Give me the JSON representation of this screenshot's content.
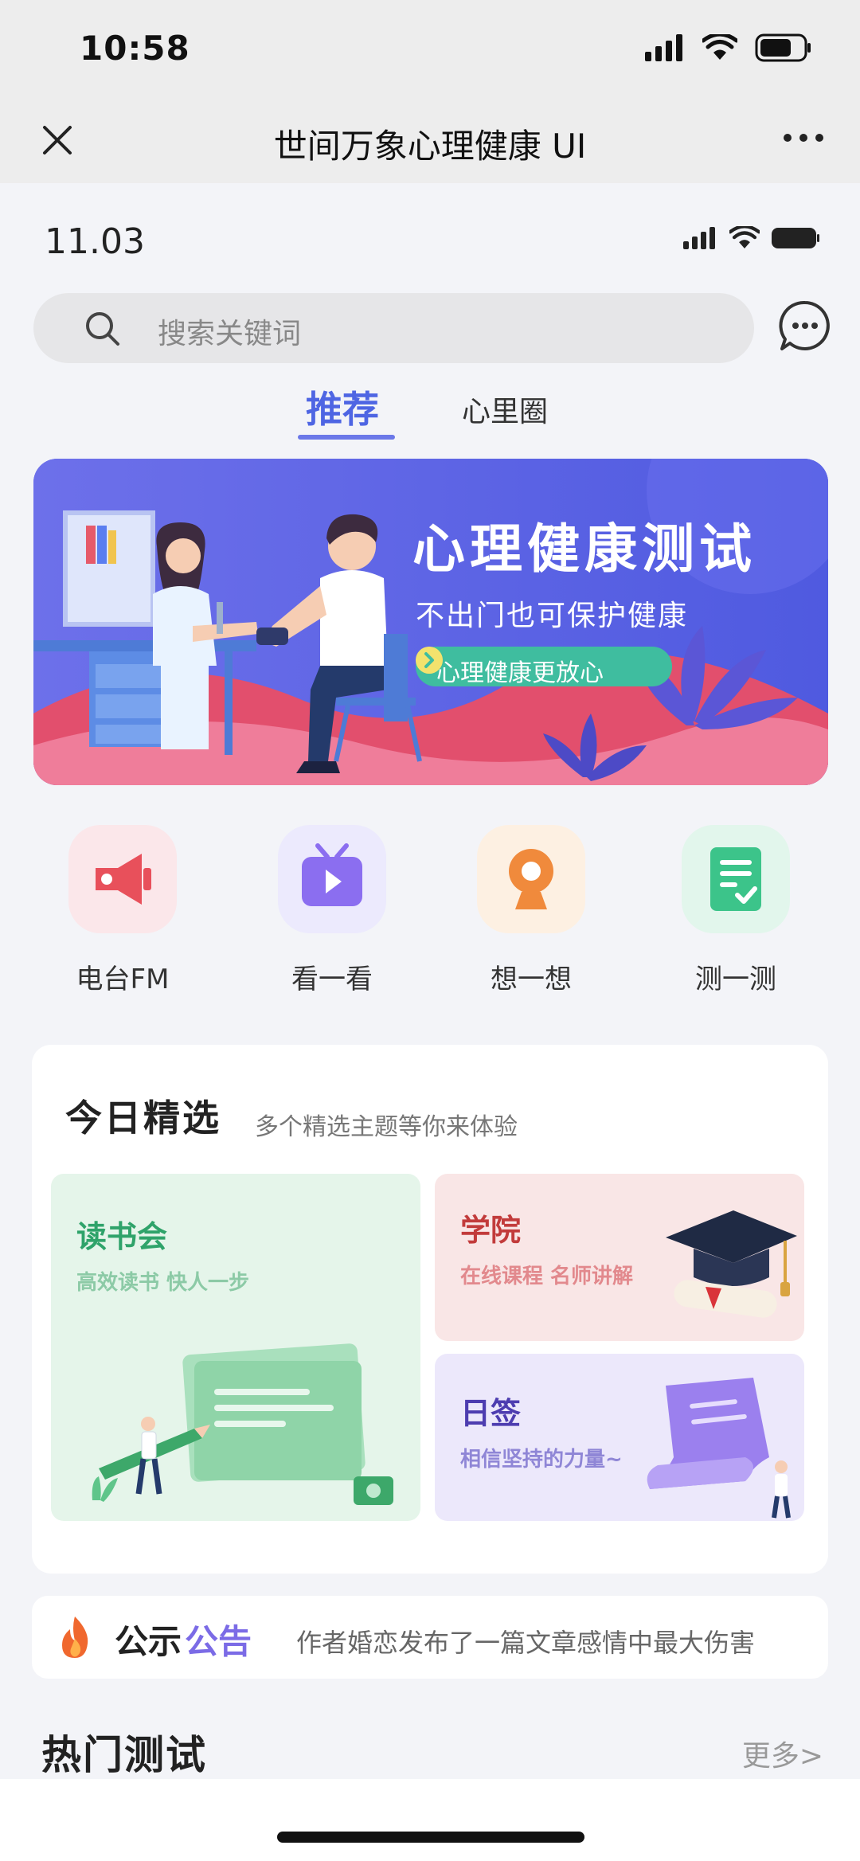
{
  "system": {
    "time": "10:58"
  },
  "navbar": {
    "title": "世间万象心理健康 UI"
  },
  "inner_status": {
    "time": "11.03"
  },
  "search": {
    "placeholder": "搜索关键词"
  },
  "tabs": [
    {
      "label": "推荐"
    },
    {
      "label": "心里圈"
    }
  ],
  "banner": {
    "title": "心理健康测试",
    "subtitle": "不出门也可保护健康",
    "button": "心理健康更放心"
  },
  "quick_entries": [
    {
      "label": "电台FM",
      "icon": "megaphone-icon",
      "color": "#e8505b"
    },
    {
      "label": "看一看",
      "icon": "tv-icon",
      "color": "#8b6ef0"
    },
    {
      "label": "想一想",
      "icon": "webcam-icon",
      "color": "#f08a3c"
    },
    {
      "label": "测一测",
      "icon": "checklist-icon",
      "color": "#3cc48a"
    }
  ],
  "today": {
    "title": "今日精选",
    "subtitle": "多个精选主题等你来体验",
    "tiles": [
      {
        "title": "读书会",
        "subtitle": "高效读书 快人一步"
      },
      {
        "title": "学院",
        "subtitle": "在线课程 名师讲解"
      },
      {
        "title": "日签",
        "subtitle": "相信坚持的力量~"
      }
    ]
  },
  "notice": {
    "label_a": "公示",
    "label_b": "公告",
    "text": "作者婚恋发布了一篇文章感情中最大伤害"
  },
  "hot": {
    "title": "热门测试",
    "more": "更多>"
  }
}
